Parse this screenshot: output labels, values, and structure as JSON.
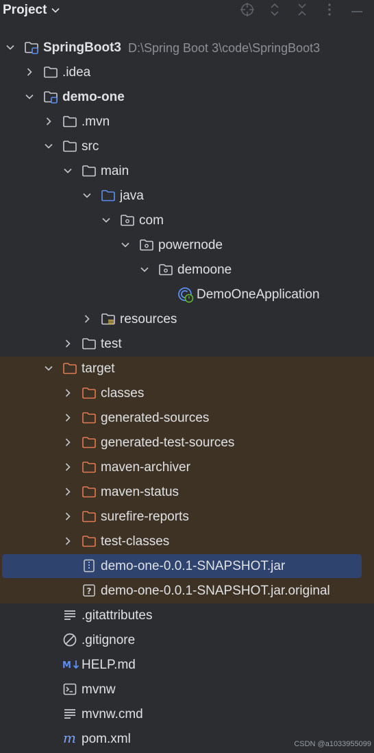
{
  "panel": {
    "title": "Project",
    "tool_icons": [
      "crosshair-icon",
      "expand-collapse-icon",
      "collapse-all-icon",
      "more-options-icon",
      "minimize-icon"
    ]
  },
  "colors": {
    "background": "#2b2d30",
    "excluded_row": "#3e3224",
    "selected_row": "#2e436e",
    "folder_default": "#c9ccd1",
    "folder_source": "#5c8ff0",
    "folder_excluded": "#e07b53"
  },
  "tree": [
    {
      "label": "SpringBoot3",
      "path": "D:\\Spring Boot 3\\code\\SpringBoot3",
      "bold": true,
      "expanded": true,
      "icon": "module-folder-icon"
    },
    {
      "label": ".idea",
      "expanded": false,
      "icon": "folder-icon"
    },
    {
      "label": "demo-one",
      "bold": true,
      "expanded": true,
      "icon": "module-folder-icon"
    },
    {
      "label": ".mvn",
      "expanded": false,
      "icon": "folder-icon"
    },
    {
      "label": "src",
      "expanded": true,
      "icon": "folder-icon"
    },
    {
      "label": "main",
      "expanded": true,
      "icon": "folder-icon"
    },
    {
      "label": "java",
      "expanded": true,
      "icon": "source-folder-icon"
    },
    {
      "label": "com",
      "expanded": true,
      "icon": "package-icon"
    },
    {
      "label": "powernode",
      "expanded": true,
      "icon": "package-icon"
    },
    {
      "label": "demoone",
      "expanded": true,
      "icon": "package-icon"
    },
    {
      "label": "DemoOneApplication",
      "icon": "spring-boot-class-icon"
    },
    {
      "label": "resources",
      "expanded": false,
      "icon": "resources-folder-icon"
    },
    {
      "label": "test",
      "expanded": false,
      "icon": "folder-icon"
    },
    {
      "label": "target",
      "expanded": true,
      "icon": "excluded-folder-icon",
      "excluded": true
    },
    {
      "label": "classes",
      "expanded": false,
      "icon": "excluded-folder-icon",
      "excluded": true
    },
    {
      "label": "generated-sources",
      "expanded": false,
      "icon": "excluded-folder-icon",
      "excluded": true
    },
    {
      "label": "generated-test-sources",
      "expanded": false,
      "icon": "excluded-folder-icon",
      "excluded": true
    },
    {
      "label": "maven-archiver",
      "expanded": false,
      "icon": "excluded-folder-icon",
      "excluded": true
    },
    {
      "label": "maven-status",
      "expanded": false,
      "icon": "excluded-folder-icon",
      "excluded": true
    },
    {
      "label": "surefire-reports",
      "expanded": false,
      "icon": "excluded-folder-icon",
      "excluded": true
    },
    {
      "label": "test-classes",
      "expanded": false,
      "icon": "excluded-folder-icon",
      "excluded": true
    },
    {
      "label": "demo-one-0.0.1-SNAPSHOT.jar",
      "icon": "jar-file-icon",
      "excluded": true,
      "selected": true
    },
    {
      "label": "demo-one-0.0.1-SNAPSHOT.jar.original",
      "icon": "unknown-file-icon",
      "excluded": true
    },
    {
      "label": ".gitattributes",
      "icon": "text-file-icon"
    },
    {
      "label": ".gitignore",
      "icon": "ignore-file-icon"
    },
    {
      "label": "HELP.md",
      "icon": "markdown-file-icon"
    },
    {
      "label": "mvnw",
      "icon": "shell-script-icon"
    },
    {
      "label": "mvnw.cmd",
      "icon": "text-file-icon"
    },
    {
      "label": "pom.xml",
      "icon": "maven-file-icon"
    }
  ],
  "watermark": "CSDN @a1033955099"
}
